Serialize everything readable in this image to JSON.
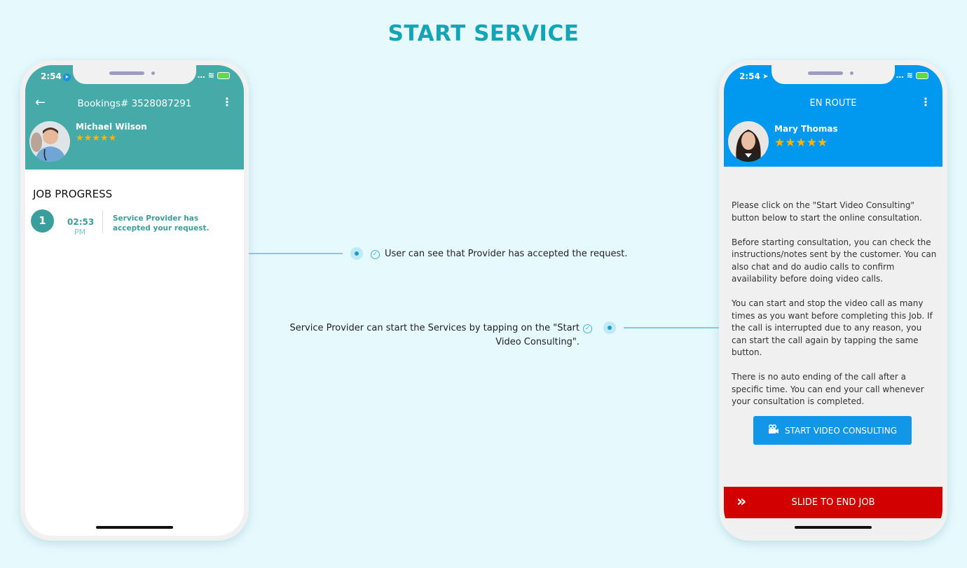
{
  "page": {
    "title": "START SERVICE"
  },
  "colors": {
    "title": "#12a5b5",
    "left_header": "#45aaa8",
    "right_header": "#0198f0",
    "video_button": "#1296e8",
    "slide_bar": "#d20000",
    "stars": "#ffb400"
  },
  "left_phone": {
    "status_time": "2:54",
    "header_title": "Bookings# 3528087291",
    "back_icon": "←",
    "more_icon": "⋮",
    "provider_name": "Michael Wilson",
    "rating": 5,
    "stars": "★★★★★",
    "job_progress_title": "JOB PROGRESS",
    "steps": [
      {
        "number": "1",
        "time": "02:53",
        "ampm": "PM",
        "text": "Service Provider has accepted your request."
      }
    ]
  },
  "right_phone": {
    "status_time": "2:54",
    "header_title": "EN ROUTE",
    "more_icon": "⋮",
    "customer_name": "Mary Thomas",
    "rating": 5,
    "stars": "★★★★★",
    "paragraphs": [
      "Please click on the \"Start Video Consulting\" button below to start the online consultation.",
      "Before starting consultation, you can check the instructions/notes sent by the customer. You can also chat and do audio calls to confirm availability before doing video calls.",
      "You can start and stop the video call as many times as you want before completing this Job. If the call is interrupted due to any reason, you can start the call again by tapping the same button.",
      "There is no auto ending of the call after a specific time. You can end your call whenever your consultation is completed."
    ],
    "video_button_label": "START VIDEO CONSULTING",
    "slide_label": "SLIDE TO END JOB",
    "slide_icon": "»"
  },
  "callouts": [
    {
      "text": "User can see that Provider has accepted the request."
    },
    {
      "text": "Service Provider can start the Services by tapping on the \"Start Video Consulting\"."
    }
  ]
}
